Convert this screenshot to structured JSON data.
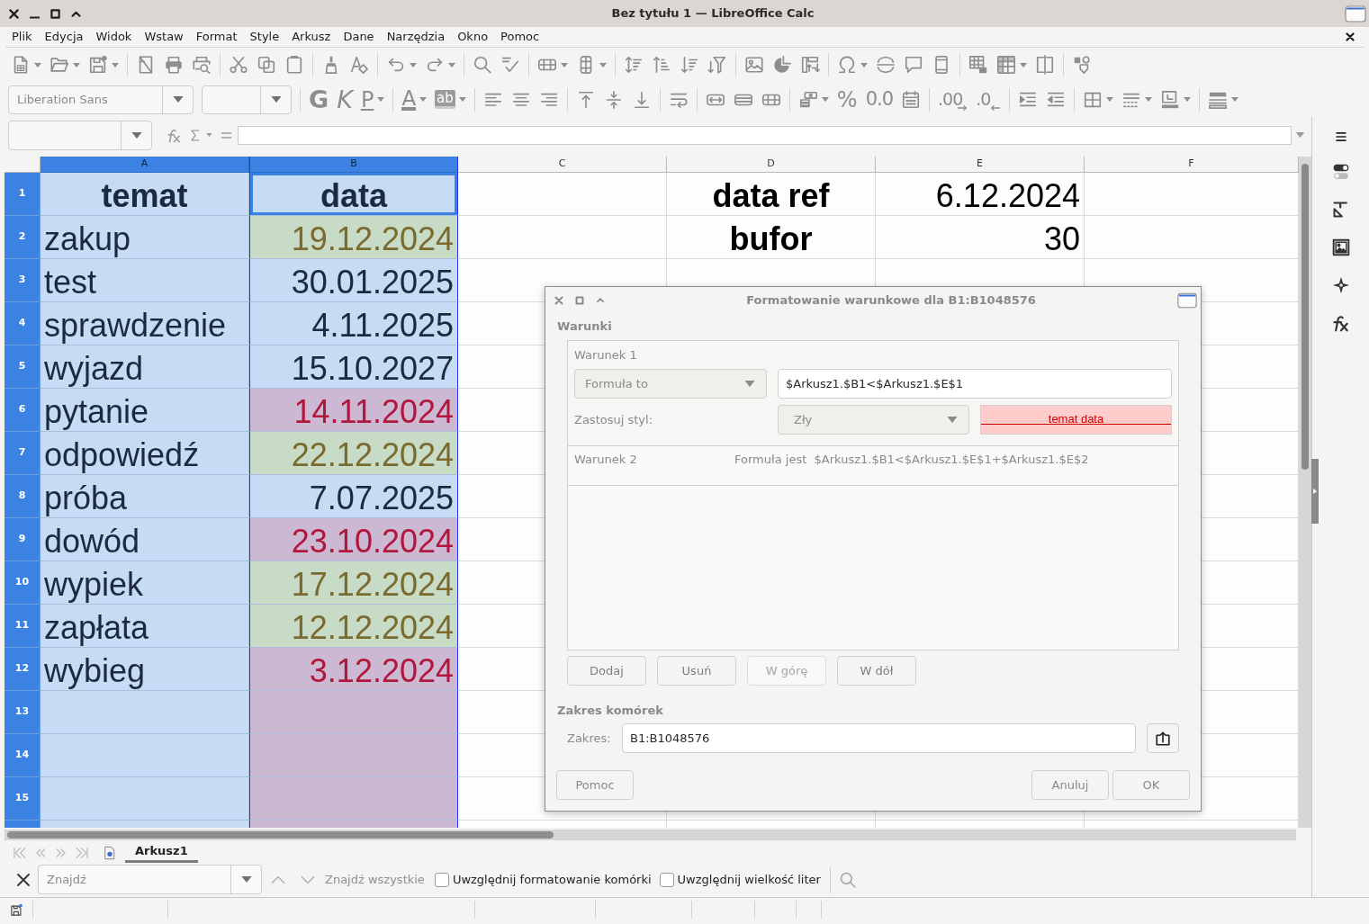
{
  "window": {
    "title": "Bez tytułu 1 — LibreOffice Calc"
  },
  "menu": [
    "Plik",
    "Edycja",
    "Widok",
    "Wstaw",
    "Format",
    "Style",
    "Arkusz",
    "Dane",
    "Narzędzia",
    "Okno",
    "Pomoc"
  ],
  "format_toolbar": {
    "font_name": "Liberation Sans",
    "buttons": [
      {
        "label": "G"
      },
      {
        "label": "K"
      },
      {
        "label": "P"
      },
      {
        "label": "A"
      },
      {
        "label": "ab"
      },
      {
        "label": "%"
      },
      {
        "label": "0.0"
      },
      {
        "label": ".00"
      },
      {
        "label": ".0"
      }
    ]
  },
  "sheet": {
    "columns": [
      {
        "label": "A",
        "selected": true,
        "referenced": false
      },
      {
        "label": "B",
        "selected": true,
        "referenced": true
      },
      {
        "label": "C",
        "selected": false,
        "referenced": false
      },
      {
        "label": "D",
        "selected": false,
        "referenced": false
      },
      {
        "label": "E",
        "selected": false,
        "referenced": false
      },
      {
        "label": "F",
        "selected": false,
        "referenced": false
      }
    ],
    "rows": [
      {
        "label": "1",
        "selected": true,
        "A": {
          "text": "temat",
          "kind": "header"
        },
        "B": {
          "text": "data",
          "kind": "header",
          "bad": false,
          "neutral": false,
          "active": true
        },
        "D": {
          "text": "data ref",
          "kind": "header"
        },
        "E": {
          "text": "6.12.2024",
          "kind": "number"
        }
      },
      {
        "label": "2",
        "selected": true,
        "A": {
          "text": "zakup",
          "kind": "text"
        },
        "B": {
          "text": "19.12.2024",
          "kind": "number",
          "bad": false,
          "neutral": true
        },
        "D": {
          "text": "bufor",
          "kind": "header"
        },
        "E": {
          "text": "30",
          "kind": "number"
        }
      },
      {
        "label": "3",
        "selected": true,
        "A": {
          "text": "test",
          "kind": "text"
        },
        "B": {
          "text": "30.01.2025",
          "kind": "number",
          "bad": false,
          "neutral": false
        }
      },
      {
        "label": "4",
        "selected": true,
        "A": {
          "text": "sprawdzenie",
          "kind": "text"
        },
        "B": {
          "text": "4.11.2025",
          "kind": "number",
          "bad": false,
          "neutral": false
        }
      },
      {
        "label": "5",
        "selected": true,
        "A": {
          "text": "wyjazd",
          "kind": "text"
        },
        "B": {
          "text": "15.10.2027",
          "kind": "number",
          "bad": false,
          "neutral": false
        }
      },
      {
        "label": "6",
        "selected": true,
        "A": {
          "text": "pytanie",
          "kind": "text"
        },
        "B": {
          "text": "14.11.2024",
          "kind": "number",
          "bad": true,
          "neutral": false
        }
      },
      {
        "label": "7",
        "selected": true,
        "A": {
          "text": "odpowiedź",
          "kind": "text"
        },
        "B": {
          "text": "22.12.2024",
          "kind": "number",
          "bad": false,
          "neutral": true
        }
      },
      {
        "label": "8",
        "selected": true,
        "A": {
          "text": "próba",
          "kind": "text"
        },
        "B": {
          "text": "7.07.2025",
          "kind": "number",
          "bad": false,
          "neutral": false
        }
      },
      {
        "label": "9",
        "selected": true,
        "A": {
          "text": "dowód",
          "kind": "text"
        },
        "B": {
          "text": "23.10.2024",
          "kind": "number",
          "bad": true,
          "neutral": false
        }
      },
      {
        "label": "10",
        "selected": true,
        "A": {
          "text": "wypiek",
          "kind": "text"
        },
        "B": {
          "text": "17.12.2024",
          "kind": "number",
          "bad": false,
          "neutral": true
        }
      },
      {
        "label": "11",
        "selected": true,
        "A": {
          "text": "zapłata",
          "kind": "text"
        },
        "B": {
          "text": "12.12.2024",
          "kind": "number",
          "bad": false,
          "neutral": true
        }
      },
      {
        "label": "12",
        "selected": true,
        "A": {
          "text": "wybieg",
          "kind": "text"
        },
        "B": {
          "text": "3.12.2024",
          "kind": "number",
          "bad": true,
          "neutral": false
        }
      },
      {
        "label": "13",
        "selected": true,
        "B": {
          "bad": true,
          "neutral": false
        }
      },
      {
        "label": "14",
        "selected": true,
        "B": {
          "bad": true,
          "neutral": false
        }
      },
      {
        "label": "15",
        "selected": true,
        "B": {
          "bad": true,
          "neutral": false
        }
      }
    ]
  },
  "sheet_tabs": [
    {
      "label": "Arkusz1",
      "selected": true
    }
  ],
  "find_bar": {
    "placeholder": "Znajdź",
    "find_all": "Znajdź wszystkie",
    "options": [
      {
        "label": "Uwzględnij formatowanie komórki",
        "checked": false
      },
      {
        "label": "Uwzględnij wielkość liter",
        "checked": false
      }
    ]
  },
  "dialog": {
    "title": "Formatowanie warunkowe dla B1:B1048576",
    "conditions_heading": "Warunki",
    "conditions": [
      {
        "label": "Warunek 1",
        "expanded": true,
        "type": "Formuła to",
        "formula": "$Arkusz1.$B1<$Arkusz1.$E$1",
        "style_label": "Zastosuj styl:",
        "style": "Zły",
        "preview": "temat data"
      },
      {
        "label": "Warunek 2",
        "expanded": false,
        "summary": "Formuła jest  $Arkusz1.$B1<$Arkusz1.$E$1+$Arkusz1.$E$2"
      }
    ],
    "list_buttons": [
      {
        "label": "Dodaj",
        "disabled": false
      },
      {
        "label": "Usuń",
        "disabled": false
      },
      {
        "label": "W górę",
        "disabled": true
      },
      {
        "label": "W dół",
        "disabled": false
      }
    ],
    "range_heading": "Zakres komórek",
    "range_label": "Zakres:",
    "range": "B1:B1048576",
    "buttons": [
      {
        "label": "Pomoc"
      },
      {
        "label": "Anuluj"
      },
      {
        "label": "OK"
      }
    ]
  }
}
